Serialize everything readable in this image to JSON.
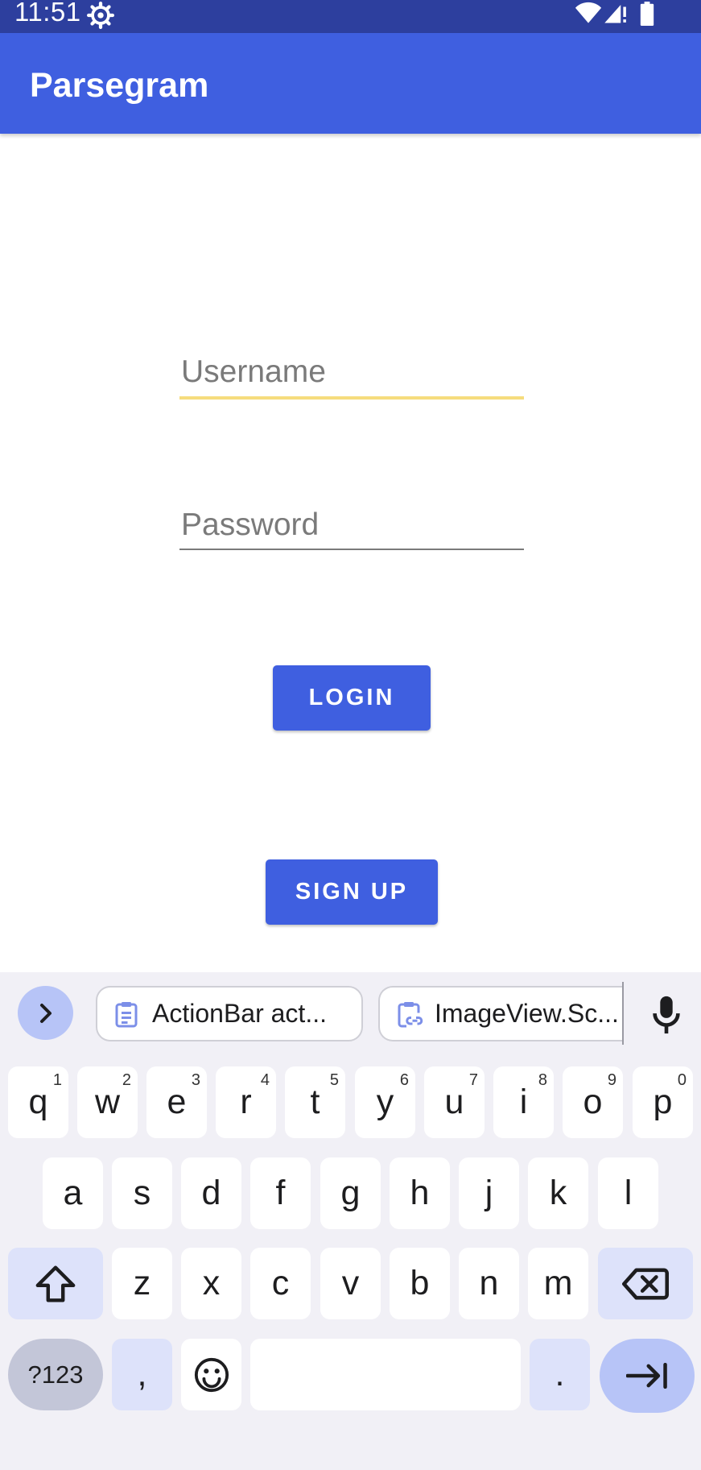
{
  "status_bar": {
    "time": "11:51",
    "icons": [
      "settings-gear-icon",
      "wifi-icon",
      "cellular-alert-icon",
      "battery-icon"
    ]
  },
  "app_bar": {
    "title": "Parsegram"
  },
  "form": {
    "username_placeholder": "Username",
    "password_placeholder": "Password",
    "login_label": "LOGIN",
    "signup_label": "SIGN UP"
  },
  "keyboard": {
    "suggestions": [
      "ActionBar act...",
      "ImageView.Sc..."
    ],
    "row1": [
      {
        "l": "q",
        "s": "1"
      },
      {
        "l": "w",
        "s": "2"
      },
      {
        "l": "e",
        "s": "3"
      },
      {
        "l": "r",
        "s": "4"
      },
      {
        "l": "t",
        "s": "5"
      },
      {
        "l": "y",
        "s": "6"
      },
      {
        "l": "u",
        "s": "7"
      },
      {
        "l": "i",
        "s": "8"
      },
      {
        "l": "o",
        "s": "9"
      },
      {
        "l": "p",
        "s": "0"
      }
    ],
    "row2": [
      "a",
      "s",
      "d",
      "f",
      "g",
      "h",
      "j",
      "k",
      "l"
    ],
    "row3": [
      "z",
      "x",
      "c",
      "v",
      "b",
      "n",
      "m"
    ],
    "symbols_label": "?123",
    "comma_label": ",",
    "period_label": "."
  },
  "colors": {
    "status_bar": "#2d3f9e",
    "primary": "#3f5fe0",
    "focus_underline": "#f6dc7d",
    "keyboard_bg": "#f1f0f6"
  }
}
